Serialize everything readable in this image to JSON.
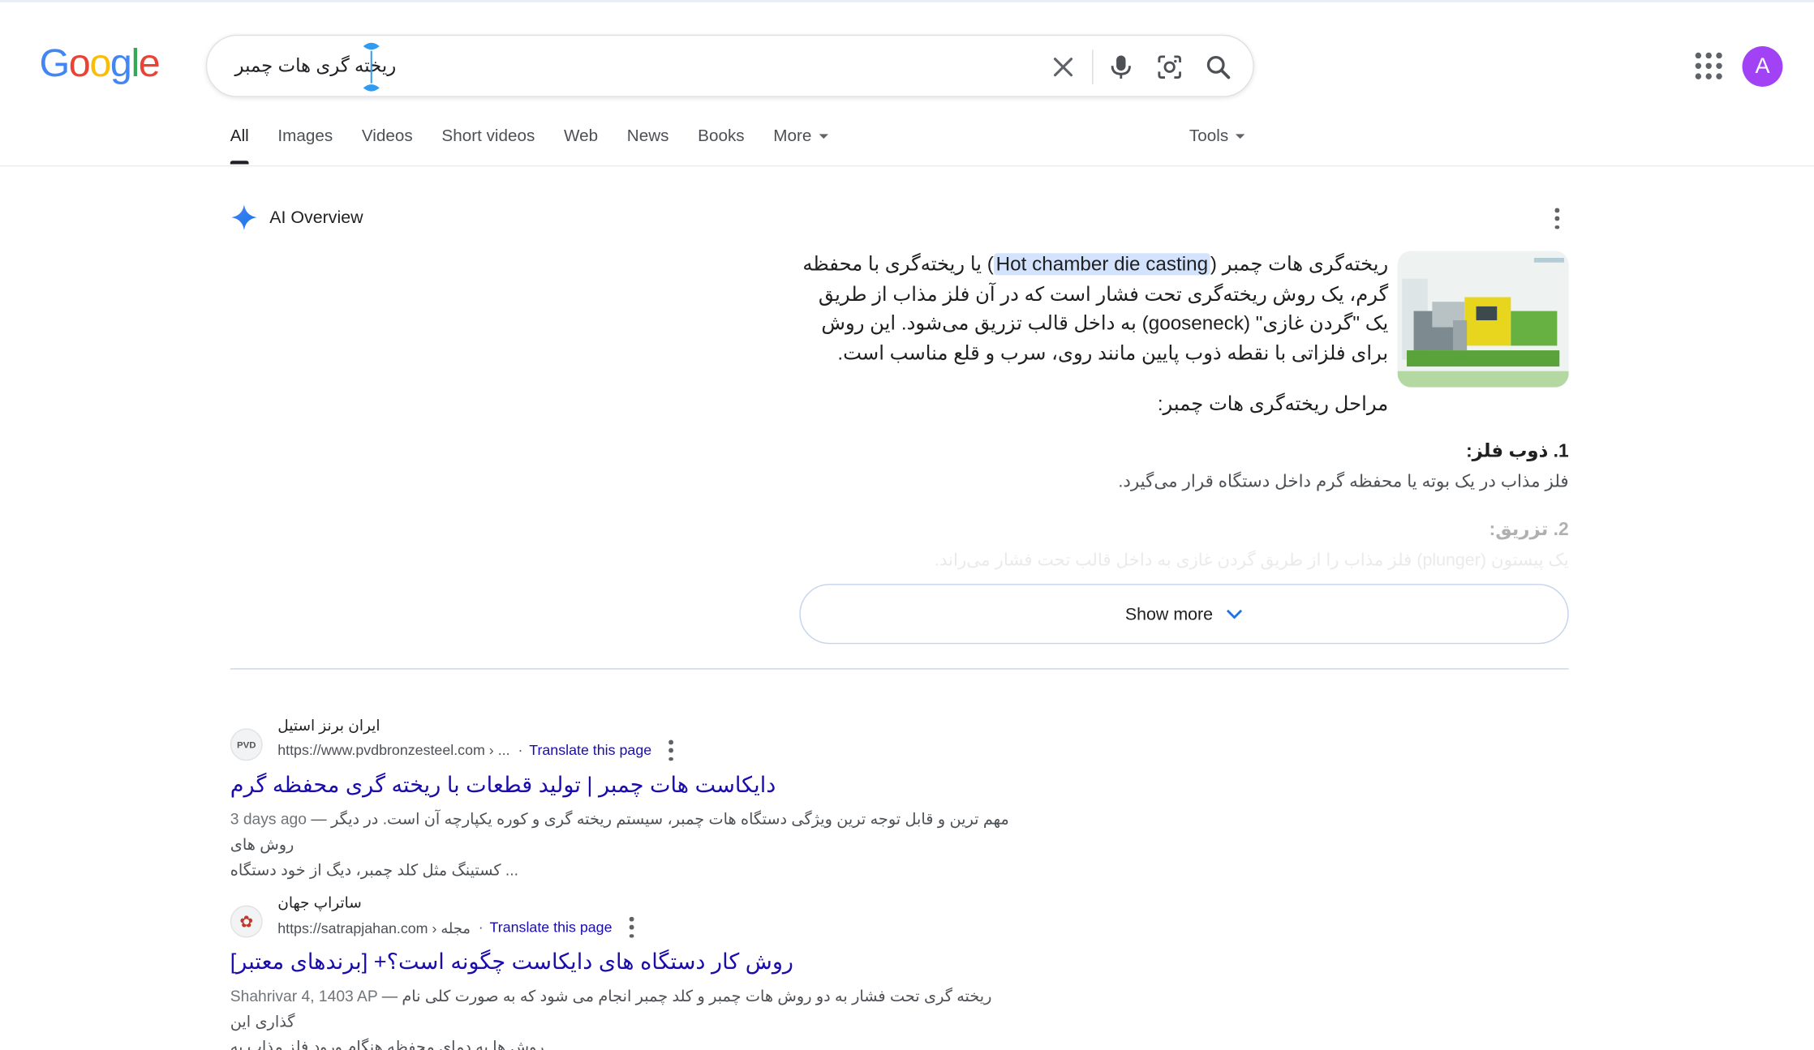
{
  "logo": {
    "letters": [
      "G",
      "o",
      "o",
      "g",
      "l",
      "e"
    ],
    "colors": [
      "#4285F4",
      "#EA4335",
      "#FBBC05",
      "#4285F4",
      "#34A853",
      "#EA4335"
    ]
  },
  "search": {
    "query": "ریخته گری هات چمبر"
  },
  "account": {
    "avatar_letter": "A",
    "avatar_color": "#a142f4"
  },
  "tabs": [
    {
      "label": "All",
      "active": true
    },
    {
      "label": "Images"
    },
    {
      "label": "Videos"
    },
    {
      "label": "Short videos"
    },
    {
      "label": "Web"
    },
    {
      "label": "News"
    },
    {
      "label": "Books"
    },
    {
      "label": "More"
    }
  ],
  "tools_label": "Tools",
  "ai_overview": {
    "title": "AI Overview",
    "para_part1": "ریخته‌گری هات چمبر (",
    "highlight": "Hot chamber die casting",
    "para_part2": ") یا ریخته‌گری با محفظه گرم، یک روش ریخته‌گری تحت فشار است که در آن فلز مذاب از طریق یک \"گردن غازی\" (gooseneck) به داخل قالب تزریق می‌شود. این روش برای فلزاتی با نقطه ذوب پایین مانند روی، سرب و قلع مناسب است.",
    "steps_title": "مراحل ریخته‌گری هات چمبر:",
    "steps": [
      {
        "heading": "1. ذوب فلز:",
        "text": "فلز مذاب در یک بوته یا محفظه گرم داخل دستگاه قرار می‌گیرد."
      },
      {
        "heading": "2. تزریق:",
        "text": "یک پیستون (plunger) فلز مذاب را از طریق گردن غازی به داخل قالب تحت فشار می‌راند."
      }
    ],
    "show_more": "Show more"
  },
  "results": [
    {
      "favicon_text": "PVD",
      "site_name": "ایران برنز استیل",
      "url": "https://www.pvdbronzesteel.com › ...",
      "translate": "Translate this page",
      "title": "دایکاست هات چمبر | تولید قطعات با ریخته گری محفظه گرم",
      "date": "3 days ago",
      "snippet_line1": "مهم ترین و قابل توجه ترین ویژگی دستگاه هات چمبر، سیستم ریخته گری و کوره یکپارچه آن است. در دیگر روش های",
      "snippet_line2": "کستینگ مثل کلد چمبر، دیگ از خود دستگاه ..."
    },
    {
      "favicon_text": "✿",
      "site_name": "ساتراپ جهان",
      "url": "https://satrapjahan.com › مجله",
      "translate": "Translate this page",
      "title": "روش کار دستگاه های دایکاست چگونه است؟+ [برندهای معتبر]",
      "date": "Shahrivar 4, 1403 AP",
      "snippet_line1": "ریخته گری تحت فشار به دو روش هات چمبر و کلد چمبر انجام می شود که به صورت کلی نام گذاری این",
      "snippet_line2": "روش ها به دمای محفظه هنگام ورود فلز مذاب به ..."
    }
  ]
}
